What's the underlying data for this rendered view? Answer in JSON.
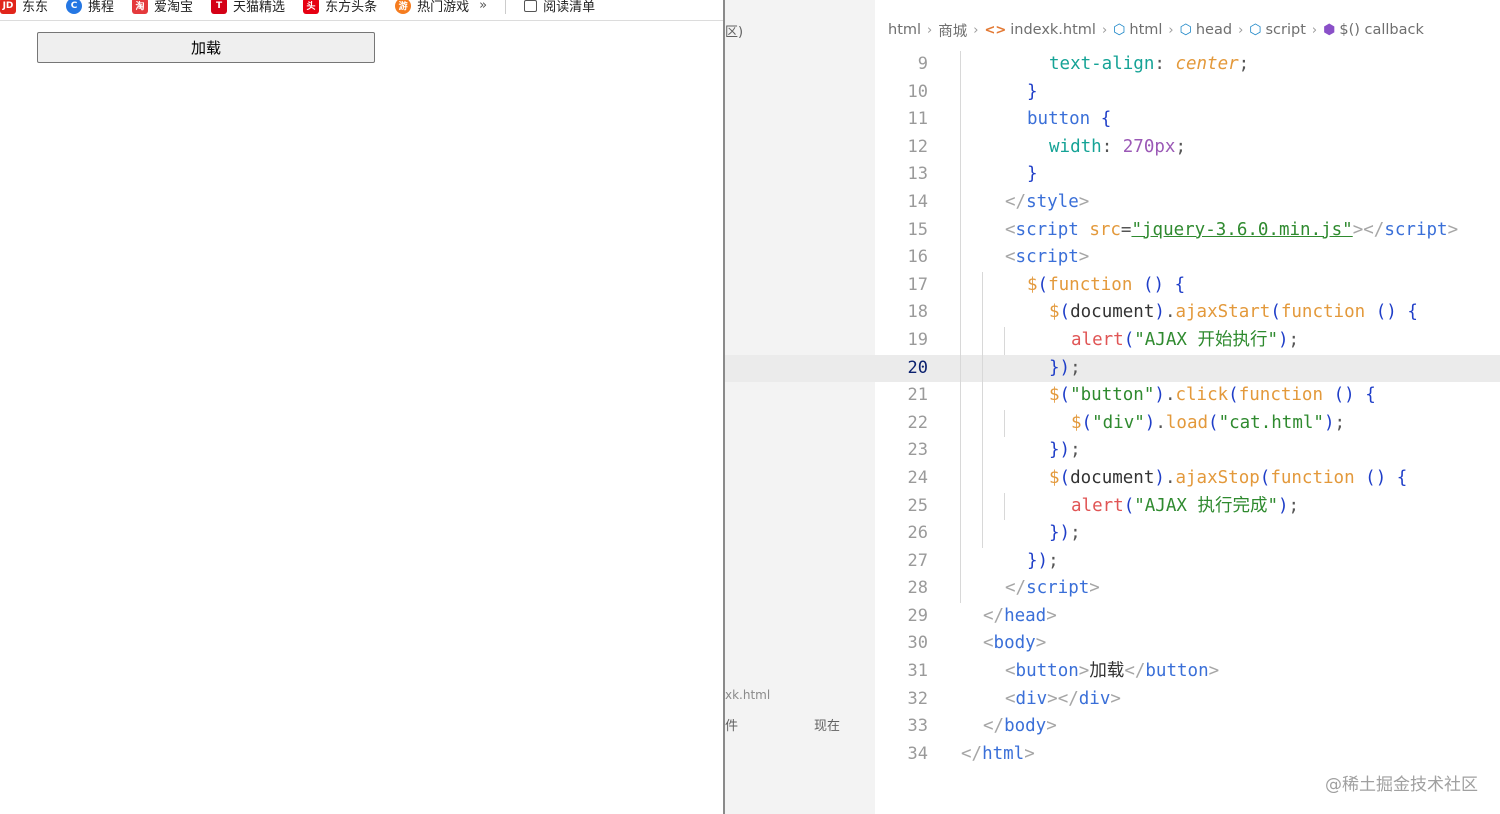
{
  "browser": {
    "bookmarks": [
      {
        "label": "东东",
        "icon": "jd-icon",
        "color": "#e1251b",
        "glyph": "JD"
      },
      {
        "label": "携程",
        "icon": "ctrip-icon",
        "color": "#2577e3",
        "glyph": "C"
      },
      {
        "label": "爱淘宝",
        "icon": "aitaobao-icon",
        "color": "#e4393c",
        "glyph": "淘"
      },
      {
        "label": "天猫精选",
        "icon": "tmall-icon",
        "color": "#d40016",
        "glyph": "T"
      },
      {
        "label": "东方头条",
        "icon": "dftoutiao-icon",
        "color": "#e60012",
        "glyph": "头"
      },
      {
        "label": "热门游戏",
        "icon": "game-icon",
        "color": "#f57c1f",
        "glyph": "游"
      }
    ],
    "bookmarks_more": "»",
    "reading_list": {
      "label": "阅读清单",
      "icon": "reading-list-icon"
    },
    "page_button": "加载"
  },
  "editor": {
    "sidebar": {
      "label_top": "区)",
      "file_label": "xk.html",
      "file_col": "件",
      "time_col": "现在"
    },
    "breadcrumb": [
      {
        "label": "html",
        "icon": ""
      },
      {
        "label": "商城",
        "icon": ""
      },
      {
        "label": "indexk.html",
        "icon": "html-file-icon"
      },
      {
        "label": "html",
        "icon": "element-icon"
      },
      {
        "label": "head",
        "icon": "element-icon"
      },
      {
        "label": "script",
        "icon": "element-icon"
      },
      {
        "label": "$() callback",
        "icon": "function-icon"
      }
    ],
    "active_line": "20",
    "watermark": "@稀土掘金技术社区"
  }
}
